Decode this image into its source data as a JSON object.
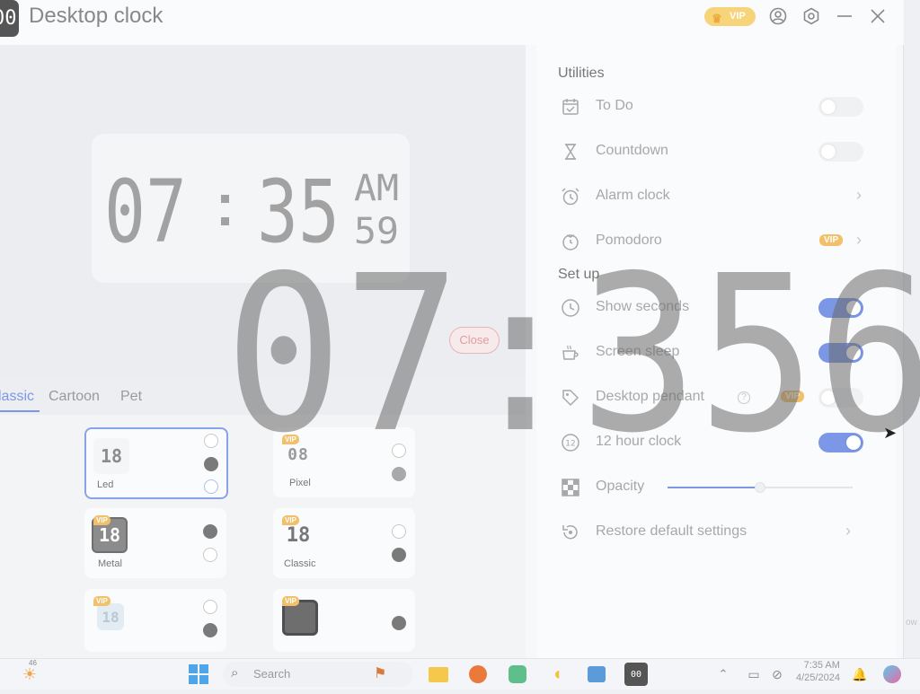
{
  "app": {
    "icon_text": "00",
    "title": "Desktop clock",
    "vip_label": "VIP"
  },
  "titlebar_icons": [
    "user-icon",
    "settings-icon",
    "minimize-icon",
    "close-icon"
  ],
  "preview_clock": {
    "hours": "07",
    "minutes": "35",
    "ampm": "AM",
    "seconds": "59"
  },
  "overlay_clock": {
    "digits": "07:356",
    "close_label": "Close"
  },
  "tabs": [
    {
      "label": "lassic",
      "active": true
    },
    {
      "label": "Cartoon",
      "active": false
    },
    {
      "label": "Pet",
      "active": false
    }
  ],
  "styles": [
    {
      "label": "Led",
      "thumb": "18",
      "vip": false,
      "selected": true
    },
    {
      "label": "Pixel",
      "thumb": "08",
      "vip": true,
      "vip_label": "VIP",
      "selected": false
    },
    {
      "label": "Metal",
      "thumb": "18",
      "vip": true,
      "vip_label": "VIP",
      "selected": false
    },
    {
      "label": "Classic",
      "thumb": "18",
      "vip": true,
      "vip_label": "VIP",
      "selected": false
    },
    {
      "label": "",
      "thumb": "18",
      "vip": true,
      "vip_label": "VIP",
      "selected": false
    },
    {
      "label": "",
      "thumb": "",
      "vip": true,
      "vip_label": "VIP",
      "selected": false
    }
  ],
  "utilities": {
    "title": "Utilities",
    "items": [
      {
        "label": "To Do",
        "icon": "calendar-check-icon",
        "control": "toggle",
        "on": false
      },
      {
        "label": "Countdown",
        "icon": "hourglass-icon",
        "control": "toggle",
        "on": false
      },
      {
        "label": "Alarm clock",
        "icon": "alarm-clock-icon",
        "control": "chevron"
      },
      {
        "label": "Pomodoro",
        "icon": "tomato-timer-icon",
        "control": "chevron",
        "vip_label": "VIP"
      }
    ]
  },
  "setup": {
    "title": "Set up",
    "items": [
      {
        "label": "Show seconds",
        "icon": "clock-icon",
        "control": "toggle",
        "on": true
      },
      {
        "label": "Screen sleep",
        "icon": "coffee-cup-icon",
        "control": "toggle",
        "on": true
      },
      {
        "label": "Desktop pendant",
        "icon": "tag-icon",
        "control": "toggle",
        "on": false,
        "vip_label": "VIP",
        "help": "?"
      },
      {
        "label": "12 hour clock",
        "icon": "12-hour-icon",
        "icon_text": "12",
        "control": "toggle",
        "on": true
      },
      {
        "label": "Opacity",
        "icon": "checkerboard-icon",
        "control": "slider",
        "value": 0.5
      },
      {
        "label": "Restore default settings",
        "icon": "restore-icon",
        "control": "chevron"
      }
    ]
  },
  "taskbar": {
    "search_placeholder": "Search",
    "time": "7:35 AM",
    "date": "4/25/2024",
    "weather_temp": "46",
    "clock_app_text": "00"
  },
  "colors": {
    "accent": "#7b97e6",
    "vip": "#f2c06a",
    "close_pill": "#e19c9c"
  }
}
